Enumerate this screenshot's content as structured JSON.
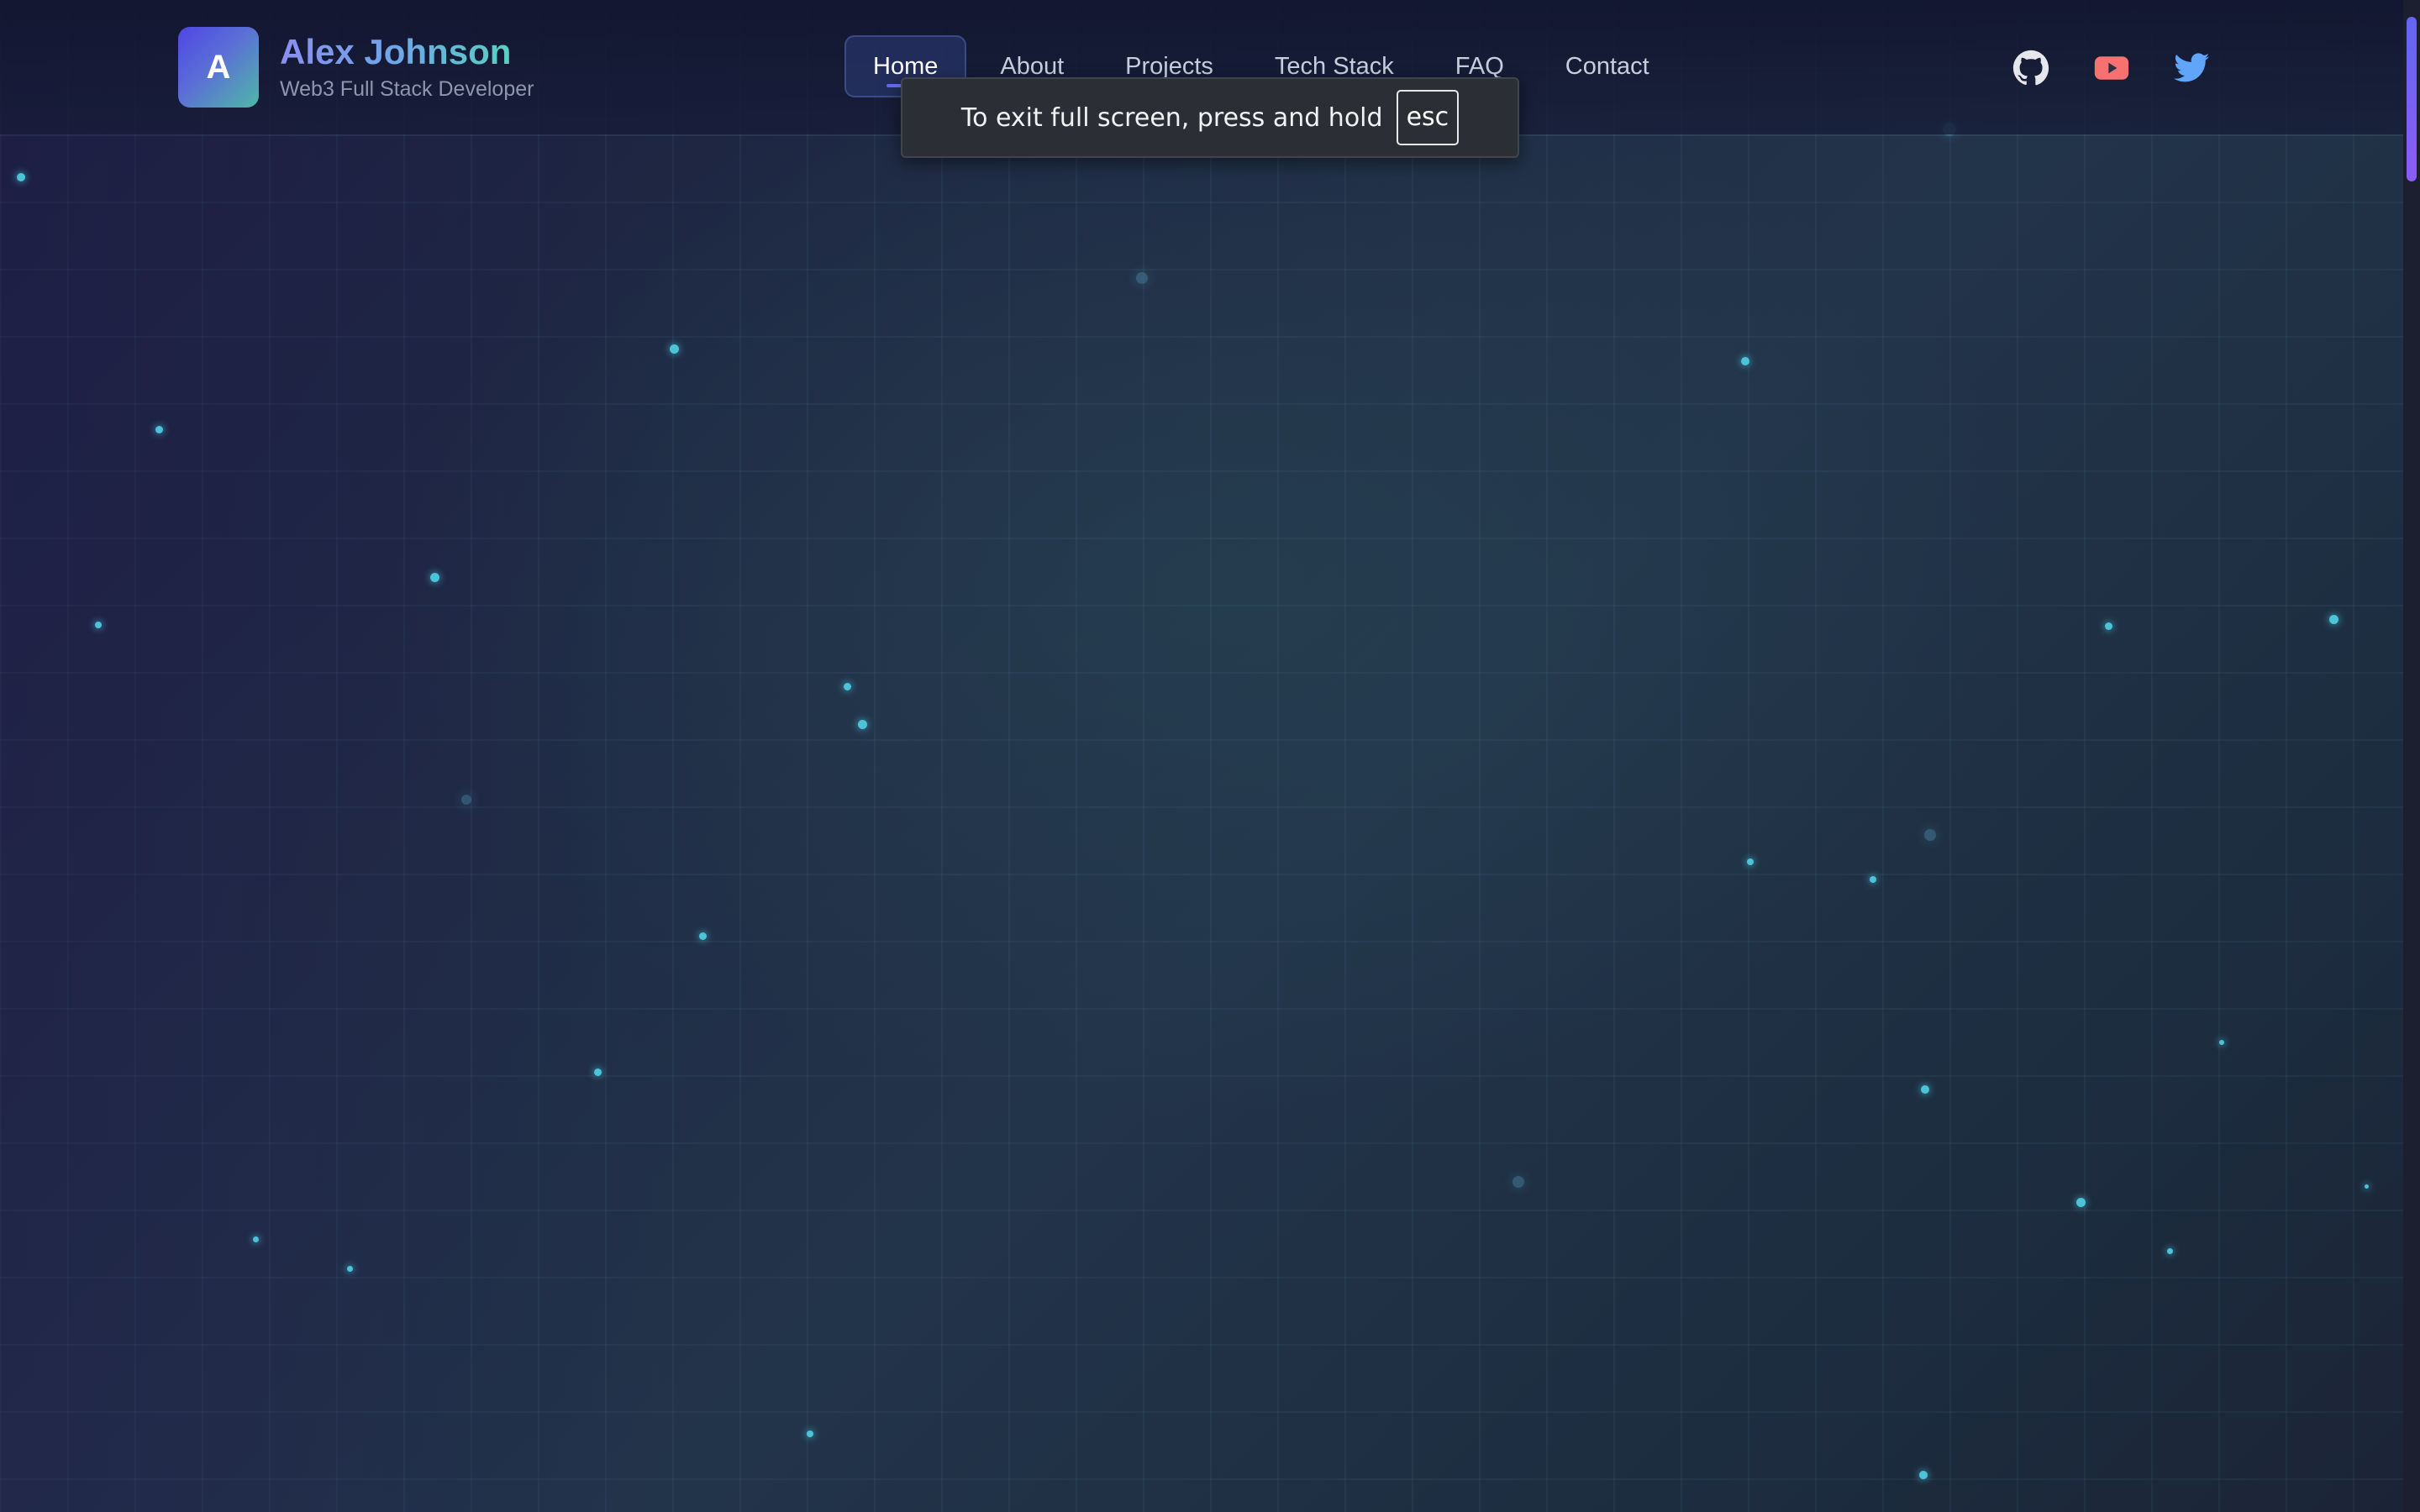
{
  "header": {
    "logo_letter": "A",
    "brand_name": "Alex Johnson",
    "brand_subtitle": "Web3 Full Stack Developer"
  },
  "nav": {
    "items": [
      {
        "label": "Home",
        "active": true
      },
      {
        "label": "About"
      },
      {
        "label": "Projects"
      },
      {
        "label": "Tech Stack"
      },
      {
        "label": "FAQ"
      },
      {
        "label": "Contact"
      }
    ]
  },
  "social": [
    {
      "icon": "github-icon",
      "color": "#e5e7eb"
    },
    {
      "icon": "youtube-icon",
      "color": "#f87171"
    },
    {
      "icon": "twitter-icon",
      "color": "#60a5fa"
    }
  ],
  "fullscreen_notice": {
    "text": "To exit full screen, press and hold",
    "key": "esc"
  },
  "colors": {
    "accent": "#6366f1",
    "particle": "#4bc3d9",
    "toast_bg": "#2b2f35"
  }
}
